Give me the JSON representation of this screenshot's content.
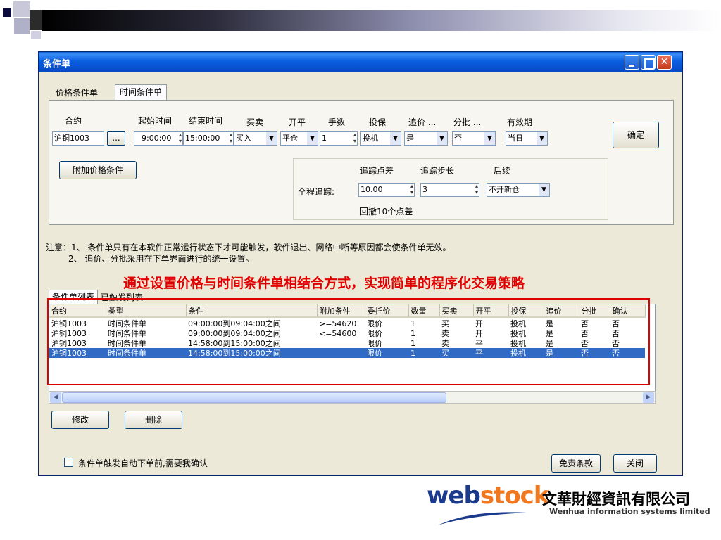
{
  "window": {
    "title": "条件单"
  },
  "tabs": [
    "价格条件单",
    "时间条件单"
  ],
  "form": {
    "labels": {
      "contract": "合约",
      "start_time": "起始时间",
      "end_time": "结束时间",
      "buy_sell": "买卖",
      "open_close": "开平",
      "quantity": "手数",
      "hedge": "投保",
      "chase": "追价 ...",
      "split": "分批 ...",
      "validity": "有效期"
    },
    "values": {
      "contract": "沪铜1003",
      "browse": "...",
      "start_time": "9:00:00",
      "end_time": "15:00:00",
      "buy_sell": "买入",
      "open_close": "平仓",
      "quantity": "1",
      "hedge": "投机",
      "chase": "是",
      "split": "否",
      "validity": "当日"
    },
    "confirm_button": "确定",
    "add_price_condition_button": "附加价格条件",
    "trailing": {
      "label": "全程追踪:",
      "point_diff_label": "追踪点差",
      "step_label": "追踪步长",
      "follow_label": "后续",
      "point_diff": "10.00",
      "step": "3",
      "follow": "不开新仓",
      "pullback_text": "回撤10个点差"
    }
  },
  "notes": {
    "line1": "注意：1、 条件单只有在本软件正常运行状态下才可能触发，软件退出、网络中断等原因都会使条件单无效。",
    "line2": "2、 追价、分批采用在下单界面进行的统一设置。"
  },
  "caption": "通过设置价格与时间条件单相结合方式，实现简单的程序化交易策略",
  "list_tabs": [
    "条件单列表",
    "已触发列表"
  ],
  "table": {
    "columns": [
      "合约",
      "类型",
      "条件",
      "附加条件",
      "委托价",
      "数量",
      "买卖",
      "开平",
      "投保",
      "追价",
      "分批",
      "确认"
    ],
    "rows": [
      [
        "沪铜1003",
        "时间条件单",
        "09:00:00到09:04:00之间",
        ">=54620",
        "限价",
        "1",
        "买",
        "开",
        "投机",
        "是",
        "否",
        "否"
      ],
      [
        "沪铜1003",
        "时间条件单",
        "09:00:00到09:04:00之间",
        "<=54600",
        "限价",
        "1",
        "卖",
        "开",
        "投机",
        "是",
        "否",
        "否"
      ],
      [
        "沪铜1003",
        "时间条件单",
        "14:58:00到15:00:00之间",
        "",
        "限价",
        "1",
        "卖",
        "平",
        "投机",
        "是",
        "否",
        "否"
      ],
      [
        "沪铜1003",
        "时间条件单",
        "14:58:00到15:00:00之间",
        "",
        "限价",
        "1",
        "买",
        "平",
        "投机",
        "是",
        "否",
        "否"
      ]
    ]
  },
  "buttons": {
    "modify": "修改",
    "delete": "删除",
    "disclaimer": "免责条款",
    "close": "关闭"
  },
  "checkbox_label": "条件单触发自动下单前,需要我确认",
  "logo": {
    "web": "web",
    "stock": "stock",
    "cn": "文華財經資訊有限公司",
    "en": "Wenhua information systems limited"
  }
}
